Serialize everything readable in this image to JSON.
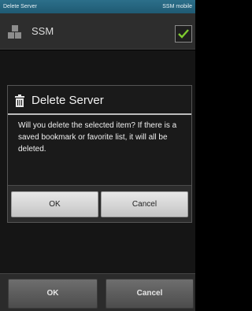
{
  "status_bar": {
    "left_text": "Delete Server",
    "right_text": "SSM mobile"
  },
  "header": {
    "title": "SSM",
    "icon": "app-blocks-icon",
    "checkbox_icon": "checkmark-icon",
    "checkbox_checked": true
  },
  "dialog": {
    "title": "Delete Server",
    "icon": "trash-icon",
    "message": "Will you delete the selected item? If there is a saved bookmark or favorite list, it will all be deleted.",
    "ok_label": "OK",
    "cancel_label": "Cancel"
  },
  "bottom_bar": {
    "ok_label": "OK",
    "cancel_label": "Cancel"
  },
  "colors": {
    "status_bar": "#2c6f8a",
    "check_accent": "#7ecb2f",
    "dialog_bg": "#1a1a1a",
    "button_bg": "#d8d8d8"
  }
}
